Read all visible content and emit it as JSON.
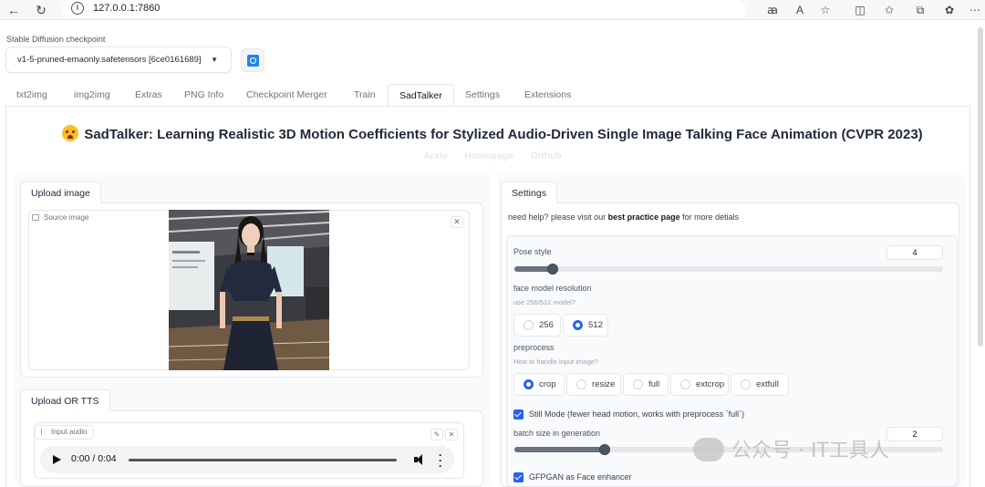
{
  "browser": {
    "url": "127.0.0.1:7860",
    "info_glyph": "i",
    "read_aloud_icon": "a-icon",
    "text_size_glyph": "A",
    "icons": [
      "back-icon",
      "reload-icon",
      "info-icon",
      "translate-icon",
      "read-aloud-icon",
      "favorite-icon",
      "split-screen-icon",
      "favorites-list-icon",
      "collections-icon",
      "extension-icon"
    ]
  },
  "checkpoint": {
    "label": "Stable Diffusion checkpoint",
    "value": "v1-5-pruned-emaonly.safetensors [6ce0161689]"
  },
  "tabs": [
    "txt2img",
    "img2img",
    "Extras",
    "PNG Info",
    "Checkpoint Merger",
    "Train",
    "SadTalker",
    "Settings",
    "Extensions"
  ],
  "active_tab": "SadTalker",
  "header": {
    "title": "SadTalker: Learning Realistic 3D Motion Coefficients for Stylized Audio-Driven Single Image Talking Face Animation (CVPR 2023)",
    "links": [
      "Arxiv",
      "Homepage",
      "Github"
    ]
  },
  "left": {
    "upload_image_tab": "Upload image",
    "source_image_label": "Source image",
    "upload_tts_tab": "Upload OR TTS",
    "input_audio_label": "Input audio",
    "audio_time": "0:00 / 0:04"
  },
  "right": {
    "settings_tab": "Settings",
    "help_prefix": "need help? please visit our ",
    "help_link": "best practice page",
    "help_suffix": " for more detials",
    "pose_style": {
      "label": "Pose style",
      "value": "4",
      "fraction": 0.09
    },
    "face_model": {
      "label": "face model resolution",
      "sub": "use 256/512 model?",
      "options": [
        "256",
        "512"
      ],
      "selected": "512"
    },
    "preprocess": {
      "label": "preprocess",
      "sub": "How to handle input image?",
      "options": [
        "crop",
        "resize",
        "full",
        "extcrop",
        "extfull"
      ],
      "selected": "crop"
    },
    "still_mode": "Still Mode (fewer head motion, works with preprocess `full`)",
    "batch_size": {
      "label": "batch size in generation",
      "value": "2",
      "fraction": 0.21
    },
    "gfpgan": "GFPGAN as Face enhancer"
  },
  "watermark": "公众号 · IT工具人"
}
